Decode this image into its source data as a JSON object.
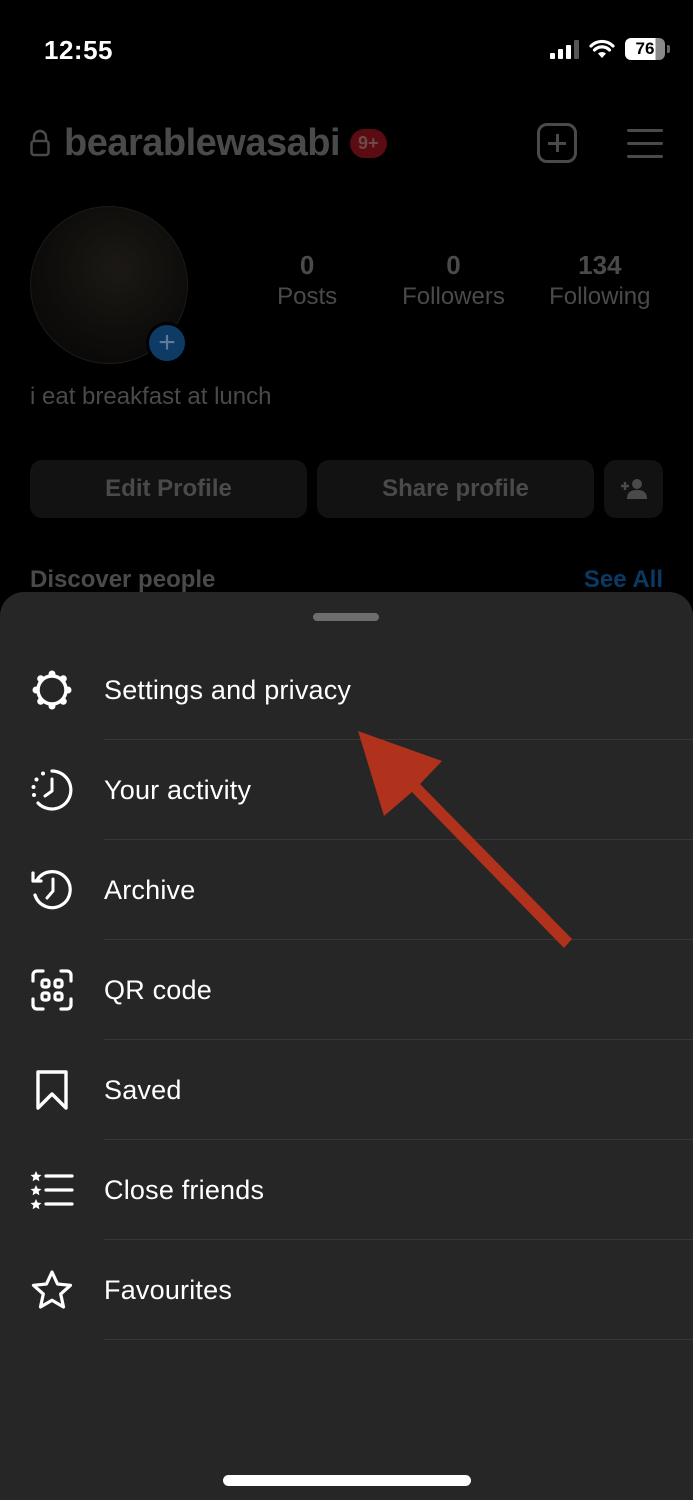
{
  "status_bar": {
    "time": "12:55",
    "battery": "76",
    "signal_bars": 3,
    "signal_bars_total": 4,
    "icons": [
      "cellular-signal-icon",
      "wifi-icon",
      "battery-icon"
    ]
  },
  "profile": {
    "username": "bearablewasabi",
    "notification_badge": "9+",
    "header_icons": [
      "lock-icon",
      "create-post-icon",
      "menu-icon"
    ],
    "stats": [
      {
        "value": "0",
        "label": "Posts"
      },
      {
        "value": "0",
        "label": "Followers"
      },
      {
        "value": "134",
        "label": "Following"
      }
    ],
    "bio": "i eat breakfast at lunch",
    "buttons": {
      "edit_profile": "Edit Profile",
      "share_profile": "Share profile"
    },
    "discover": {
      "title": "Discover people",
      "see_all": "See All"
    },
    "colors": {
      "see_all_link": "#0a3a63",
      "badge": "#5a0c12",
      "avatar_add": "#0d3b66"
    }
  },
  "sheet": {
    "items": [
      {
        "label": "Settings and privacy",
        "icon": "settings-icon"
      },
      {
        "label": "Your activity",
        "icon": "activity-icon"
      },
      {
        "label": "Archive",
        "icon": "archive-icon"
      },
      {
        "label": "QR code",
        "icon": "qr-code-icon"
      },
      {
        "label": "Saved",
        "icon": "bookmark-icon"
      },
      {
        "label": "Close friends",
        "icon": "close-friends-icon"
      },
      {
        "label": "Favourites",
        "icon": "star-icon"
      }
    ],
    "colors": {
      "background": "#262626",
      "annotation_arrow": "#b0311c"
    }
  }
}
